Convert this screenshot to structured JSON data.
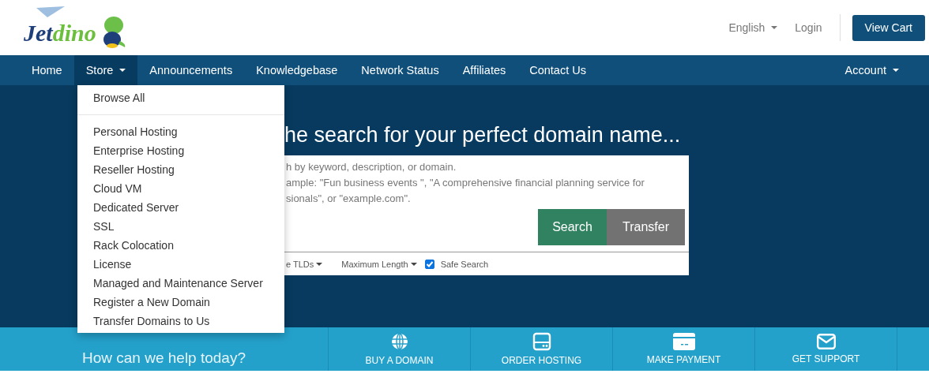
{
  "logo": {
    "words": [
      {
        "text": "Jet",
        "color": "#1f3f7a"
      },
      {
        "text": "dino",
        "color": "#6bbf3c"
      }
    ]
  },
  "top_links": [
    {
      "label": "English",
      "caret": true
    },
    {
      "label": "Login",
      "caret": false
    }
  ],
  "cart_button": "View Cart",
  "nav": {
    "items": [
      {
        "label": "Home",
        "selected": false,
        "caret": false
      },
      {
        "label": "Store",
        "selected": true,
        "caret": true
      },
      {
        "label": "Announcements",
        "selected": false,
        "caret": false
      },
      {
        "label": "Knowledgebase",
        "selected": false,
        "caret": false
      },
      {
        "label": "Network Status",
        "selected": false,
        "caret": false
      },
      {
        "label": "Affiliates",
        "selected": false,
        "caret": false
      },
      {
        "label": "Contact Us",
        "selected": false,
        "caret": false
      }
    ],
    "account": {
      "label": "Account",
      "caret": true
    }
  },
  "store_menu": {
    "groups": [
      [
        "Browse All"
      ],
      [
        "Personal Hosting",
        "Enterprise Hosting",
        "Reseller Hosting",
        "Cloud VM",
        "Dedicated Server",
        "SSL",
        "Rack Colocation",
        "License",
        "Managed and Maintenance Server",
        "Register a New Domain",
        "Transfer Domains to Us"
      ]
    ]
  },
  "hero": {
    "title": "he search for your perfect domain name...",
    "hint_lines": [
      "h by keyword, description, or domain.",
      "ample: \"Fun business events \", \"A comprehensive financial planning service for",
      "sionals\", or \"example.com\"."
    ],
    "buttons": [
      {
        "label": "Search",
        "kind": "primary"
      },
      {
        "label": "Transfer",
        "kind": "secondary"
      }
    ],
    "filters": [
      {
        "label": "e TLDs",
        "kind": "dropdown"
      },
      {
        "label": "Maximum Length",
        "kind": "dropdown"
      },
      {
        "label": "Safe Search",
        "kind": "checkbox",
        "checked": true
      }
    ]
  },
  "help_bar": {
    "title": "How can we help today?",
    "actions": [
      {
        "label": "BUY A DOMAIN"
      },
      {
        "label": "ORDER HOSTING"
      },
      {
        "label": "MAKE PAYMENT"
      },
      {
        "label": "GET SUPPORT"
      }
    ]
  }
}
